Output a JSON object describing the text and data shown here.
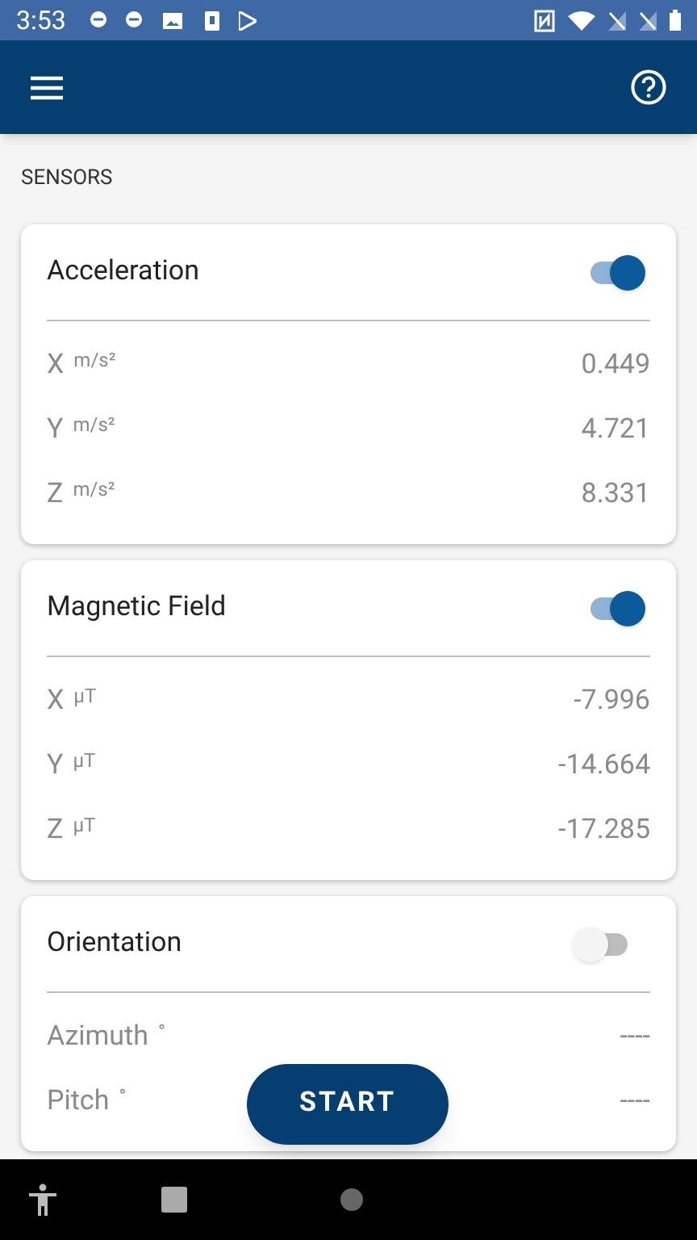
{
  "status_bar": {
    "time": "3:53"
  },
  "section_title": "SENSORS",
  "sensors": [
    {
      "title": "Acceleration",
      "on": true,
      "readings": [
        {
          "axis": "X",
          "unit": "m/s²",
          "value": "0.449"
        },
        {
          "axis": "Y",
          "unit": "m/s²",
          "value": "4.721"
        },
        {
          "axis": "Z",
          "unit": "m/s²",
          "value": "8.331"
        }
      ]
    },
    {
      "title": "Magnetic Field",
      "on": true,
      "readings": [
        {
          "axis": "X",
          "unit": "μT",
          "value": "-7.996"
        },
        {
          "axis": "Y",
          "unit": "μT",
          "value": "-14.664"
        },
        {
          "axis": "Z",
          "unit": "μT",
          "value": "-17.285"
        }
      ]
    },
    {
      "title": "Orientation",
      "on": false,
      "readings": [
        {
          "axis": "Azimuth",
          "unit": "°",
          "value": "----"
        },
        {
          "axis": "Pitch",
          "unit": "°",
          "value": "----"
        }
      ]
    }
  ],
  "start_button": "START"
}
